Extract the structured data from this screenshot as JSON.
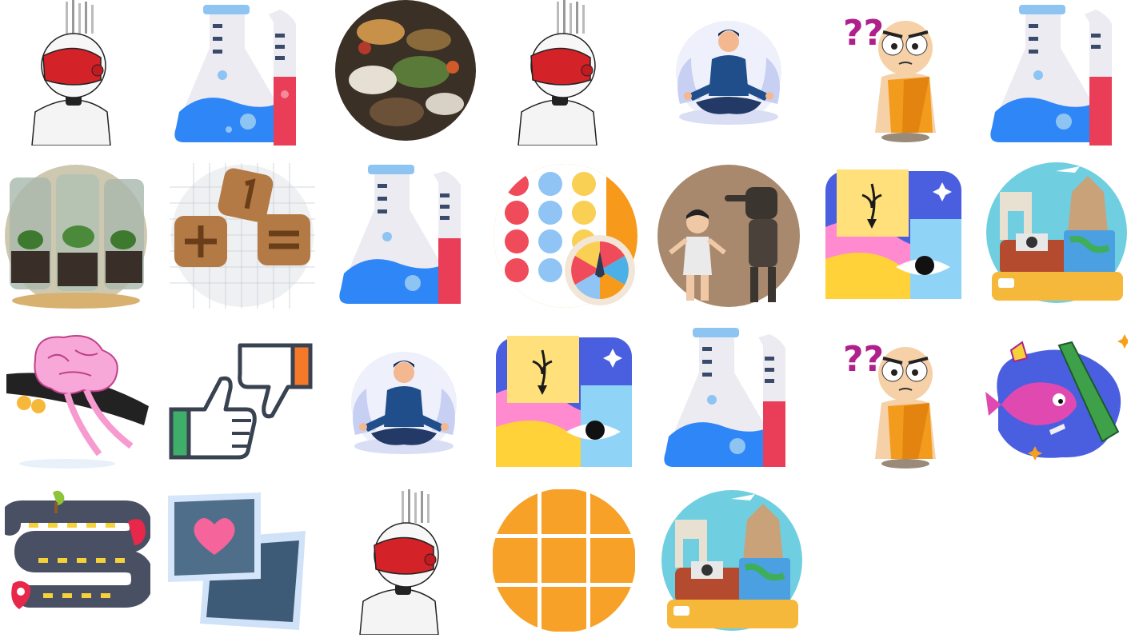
{
  "grid": {
    "rows": [
      [
        "vr-robot",
        "flask",
        "food-table",
        "vr-robot",
        "meditation",
        "confused-monk",
        "flask"
      ],
      [
        "terrarium-jars",
        "math-cookies",
        "flask",
        "connect-four-spinner",
        "child-and-robot",
        "abstract-eye",
        "travel-suitcase"
      ],
      [
        "brain-skateboard",
        "thumbs-up-down",
        "meditation",
        "abstract-eye",
        "flask",
        "confused-monk",
        "polluted-fish"
      ],
      [
        "winding-road-map",
        "heart-cards",
        "vr-robot",
        "orange-grid",
        "travel-suitcase"
      ]
    ]
  },
  "colors": {
    "background": "#ffffff",
    "flask_blue": "#2f86f6",
    "flask_red": "#ea3e58",
    "accent_orange": "#f7a128",
    "connect_blue": "#8fc4f4",
    "connect_red": "#f04b5a",
    "connect_yellow": "#f9cf54"
  }
}
